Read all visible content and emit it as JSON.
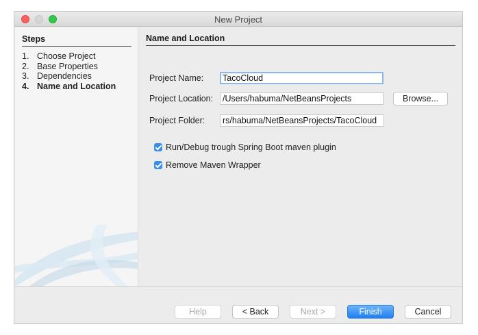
{
  "window": {
    "title": "New Project"
  },
  "steps": {
    "heading": "Steps",
    "items": [
      {
        "num": "1.",
        "label": "Choose Project"
      },
      {
        "num": "2.",
        "label": "Base Properties"
      },
      {
        "num": "3.",
        "label": "Dependencies"
      },
      {
        "num": "4.",
        "label": "Name and Location"
      }
    ],
    "current_index": 3
  },
  "form": {
    "title": "Name and Location",
    "project_name": {
      "label": "Project Name:",
      "value": "TacoCloud"
    },
    "project_location": {
      "label": "Project Location:",
      "value": "/Users/habuma/NetBeansProjects"
    },
    "project_folder": {
      "label": "Project Folder:",
      "value": "rs/habuma/NetBeansProjects/TacoCloud"
    },
    "browse_label": "Browse...",
    "run_debug": {
      "label": "Run/Debug trough Spring Boot maven plugin",
      "checked": true
    },
    "remove_wrapper": {
      "label": "Remove Maven Wrapper",
      "checked": true
    }
  },
  "buttons": {
    "help": "Help",
    "back": "< Back",
    "next": "Next >",
    "finish": "Finish",
    "cancel": "Cancel"
  },
  "colors": {
    "accent": "#3b8ee8",
    "default_button": "#1f7ff0"
  }
}
